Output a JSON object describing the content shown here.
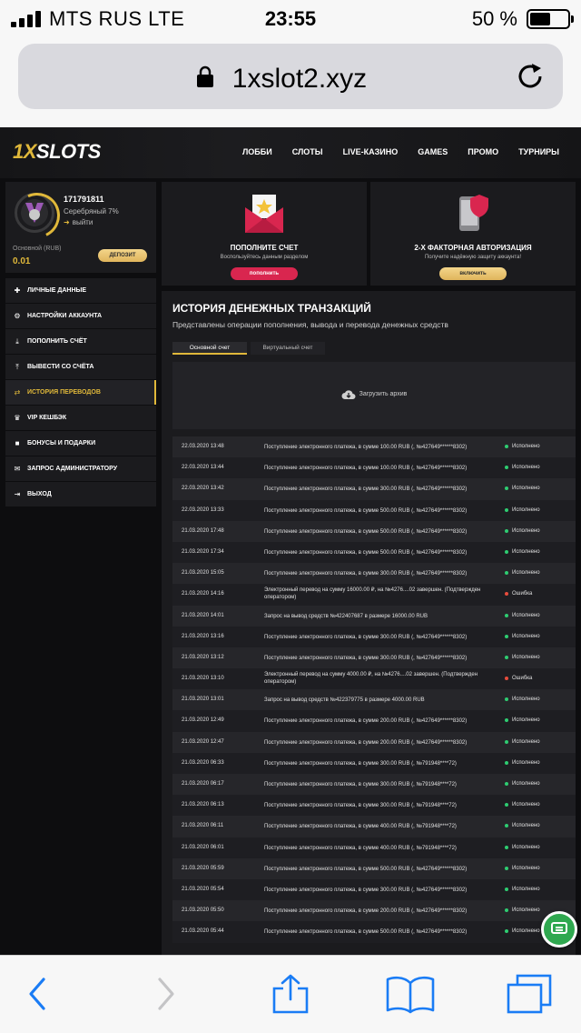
{
  "status_bar": {
    "carrier": "MTS RUS   LTE",
    "time": "23:55",
    "battery": "50 %"
  },
  "browser": {
    "url": "1xslot2.xyz"
  },
  "site": {
    "logo": {
      "one": "1X",
      "rest": "SLOTS"
    },
    "nav": [
      "ЛОББИ",
      "СЛОТЫ",
      "LIVE-КАЗИНО",
      "GAMES",
      "ПРОМО",
      "ТУРНИРЫ"
    ],
    "profile": {
      "user_id": "171791811",
      "level": "Серебряный 7%",
      "logout": "выйти",
      "account_label": "Основной (RUB)",
      "balance": "0.01",
      "deposit_button": "ДЕПОЗИТ"
    },
    "sidebar": [
      {
        "label": "ЛИЧНЫЕ ДАННЫЕ",
        "icon": "user-add-icon",
        "glyph": "✚"
      },
      {
        "label": "НАСТРОЙКИ АККАУНТА",
        "icon": "gears-icon",
        "glyph": "⚙"
      },
      {
        "label": "ПОПОЛНИТЬ СЧЁТ",
        "icon": "download-icon",
        "glyph": "⤓"
      },
      {
        "label": "ВЫВЕСТИ СО СЧЁТА",
        "icon": "upload-icon",
        "glyph": "⤒"
      },
      {
        "label": "ИСТОРИЯ ПЕРЕВОДОВ",
        "icon": "transfer-icon",
        "glyph": "⇄"
      },
      {
        "label": "VIP КЕШБЭК",
        "icon": "vip-icon",
        "glyph": "♛"
      },
      {
        "label": "БОНУСЫ И ПОДАРКИ",
        "icon": "gift-icon",
        "glyph": "■"
      },
      {
        "label": "ЗАПРОС АДМИНИСТРАТОРУ",
        "icon": "mail-icon",
        "glyph": "✉"
      },
      {
        "label": "ВЫХОД",
        "icon": "exit-icon",
        "glyph": "⇥"
      }
    ],
    "promo_cards": {
      "deposit": {
        "title": "ПОПОЛНИТЕ СЧЕТ",
        "subtitle": "Воспользуйтесь данным разделом",
        "button": "пополнить"
      },
      "twofa": {
        "title": "2-Х ФАКТОРНАЯ АВТОРИЗАЦИЯ",
        "subtitle": "Получите надёжную защиту аккаунта!",
        "button": "включить"
      }
    },
    "history": {
      "title": "ИСТОРИЯ ДЕНЕЖНЫХ ТРАНЗАКЦИЙ",
      "subtitle": "Представлены операции пополнения, вывода и перевода денежных средств",
      "tabs": [
        "Основной счет",
        "Виртуальный счет"
      ],
      "archive_label": "Загрузить архив",
      "transactions": [
        {
          "date": "22.03.2020 13:48",
          "desc": "Поступление электронного платежа, в сумме 100.00 RUB (, №427649******8302)",
          "status": "Исполнено",
          "ok": true
        },
        {
          "date": "22.03.2020 13:44",
          "desc": "Поступление электронного платежа, в сумме 100.00 RUB (, №427649******8302)",
          "status": "Исполнено",
          "ok": true
        },
        {
          "date": "22.03.2020 13:42",
          "desc": "Поступление электронного платежа, в сумме 300.00 RUB (, №427649******8302)",
          "status": "Исполнено",
          "ok": true
        },
        {
          "date": "22.03.2020 13:33",
          "desc": "Поступление электронного платежа, в сумме 500.00 RUB (, №427649******8302)",
          "status": "Исполнено",
          "ok": true
        },
        {
          "date": "21.03.2020 17:48",
          "desc": "Поступление электронного платежа, в сумме 500.00 RUB (, №427649******8302)",
          "status": "Исполнено",
          "ok": true
        },
        {
          "date": "21.03.2020 17:34",
          "desc": "Поступление электронного платежа, в сумме 500.00 RUB (, №427649******8302)",
          "status": "Исполнено",
          "ok": true
        },
        {
          "date": "21.03.2020 15:05",
          "desc": "Поступление электронного платежа, в сумме 300.00 RUB (, №427649******8302)",
          "status": "Исполнено",
          "ok": true
        },
        {
          "date": "21.03.2020 14:16",
          "desc": "Электронный перевод на сумму 16000.00 ₽, на №4276....02 завершен. (Подтвержден оператором)",
          "status": "Ошибка",
          "ok": false
        },
        {
          "date": "21.03.2020 14:01",
          "desc": "Запрос на вывод средств №422407687 в размере 16000.00 RUB",
          "status": "Исполнено",
          "ok": true
        },
        {
          "date": "21.03.2020 13:16",
          "desc": "Поступление электронного платежа, в сумме 300.00 RUB (, №427649******8302)",
          "status": "Исполнено",
          "ok": true
        },
        {
          "date": "21.03.2020 13:12",
          "desc": "Поступление электронного платежа, в сумме 300.00 RUB (, №427649******8302)",
          "status": "Исполнено",
          "ok": true
        },
        {
          "date": "21.03.2020 13:10",
          "desc": "Электронный перевод на сумму 4000.00 ₽, на №4276....02 завершен. (Подтвержден оператором)",
          "status": "Ошибка",
          "ok": false
        },
        {
          "date": "21.03.2020 13:01",
          "desc": "Запрос на вывод средств №422379775 в размере 4000.00 RUB",
          "status": "Исполнено",
          "ok": true
        },
        {
          "date": "21.03.2020 12:49",
          "desc": "Поступление электронного платежа, в сумме 200.00 RUB (, №427649******8302)",
          "status": "Исполнено",
          "ok": true
        },
        {
          "date": "21.03.2020 12:47",
          "desc": "Поступление электронного платежа, в сумме 200.00 RUB (, №427649******8302)",
          "status": "Исполнено",
          "ok": true
        },
        {
          "date": "21.03.2020 06:33",
          "desc": "Поступление электронного платежа, в сумме 300.00 RUB (, №791948****72)",
          "status": "Исполнено",
          "ok": true
        },
        {
          "date": "21.03.2020 06:17",
          "desc": "Поступление электронного платежа, в сумме 300.00 RUB (, №791948****72)",
          "status": "Исполнено",
          "ok": true
        },
        {
          "date": "21.03.2020 06:13",
          "desc": "Поступление электронного платежа, в сумме 300.00 RUB (, №791948****72)",
          "status": "Исполнено",
          "ok": true
        },
        {
          "date": "21.03.2020 06:11",
          "desc": "Поступление электронного платежа, в сумме 400.00 RUB (, №791948****72)",
          "status": "Исполнено",
          "ok": true
        },
        {
          "date": "21.03.2020 06:01",
          "desc": "Поступление электронного платежа, в сумме 400.00 RUB (, №791948****72)",
          "status": "Исполнено",
          "ok": true
        },
        {
          "date": "21.03.2020 05:59",
          "desc": "Поступление электронного платежа, в сумме 500.00 RUB (, №427649******8302)",
          "status": "Исполнено",
          "ok": true
        },
        {
          "date": "21.03.2020 05:54",
          "desc": "Поступление электронного платежа, в сумме 300.00 RUB (, №427649******8302)",
          "status": "Исполнено",
          "ok": true
        },
        {
          "date": "21.03.2020 05:50",
          "desc": "Поступление электронного платежа, в сумме 200.00 RUB (, №427649******8302)",
          "status": "Исполнено",
          "ok": true
        },
        {
          "date": "21.03.2020 05:44",
          "desc": "Поступление электронного платежа, в сумме 500.00 RUB (, №427649******8302)",
          "status": "Исполнено",
          "ok": true
        }
      ]
    }
  },
  "colors": {
    "accent_gold": "#e0b83a",
    "success": "#2ecc71",
    "error": "#e74c3c",
    "pink_button": "#d9264f",
    "ios_blue": "#1a7cf5"
  }
}
